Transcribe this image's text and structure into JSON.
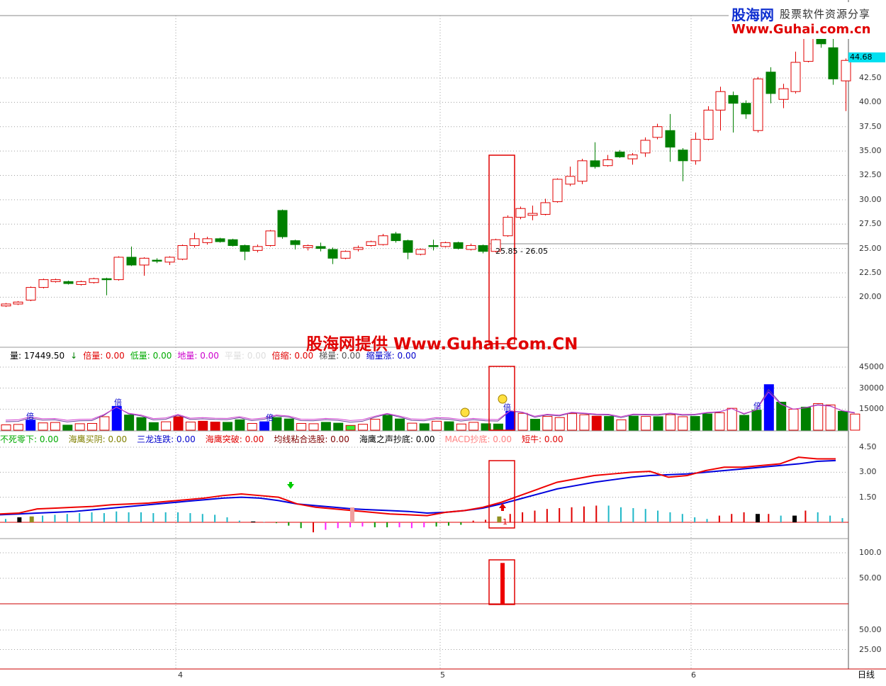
{
  "logo": {
    "brand": "股海网",
    "slogan": "股票软件资源分享",
    "url": "Www.Guhai.com.cn"
  },
  "watermark": "股海网提供 Www.Guhai.Com.CN",
  "price_panel": {
    "current_price": "44.68",
    "range_label": "25.85 - 26.05",
    "ticks": [
      "42.50",
      "40.00",
      "37.50",
      "35.00",
      "32.50",
      "30.00",
      "27.50",
      "25.00",
      "22.50",
      "20.00"
    ]
  },
  "volume_panel": {
    "items": [
      {
        "label": "量: 17449.50",
        "color": "#000000"
      },
      {
        "label": "↓",
        "color": "#008000"
      },
      {
        "label": "倍量: 0.00",
        "color": "#e00000"
      },
      {
        "label": "低量: 0.00",
        "color": "#00aa00"
      },
      {
        "label": "地量: 0.00",
        "color": "#cc00cc"
      },
      {
        "label": "平量: 0.00",
        "color": "#dddddd"
      },
      {
        "label": "倍缩: 0.00",
        "color": "#e00000"
      },
      {
        "label": "梯量: 0.00",
        "color": "#555555"
      },
      {
        "label": "缩量涨: 0.00",
        "color": "#0000cc"
      }
    ],
    "ticks": [
      "45000",
      "30000",
      "15000"
    ],
    "marker_bei": "倍"
  },
  "indicator_panel": {
    "items": [
      {
        "label": "不死零下: 0.00",
        "color": "#00aa00"
      },
      {
        "label": "海鹰买阴: 0.00",
        "color": "#808000"
      },
      {
        "label": "三龙连跌: 0.00",
        "color": "#0000cc"
      },
      {
        "label": "海鹰突破: 0.00",
        "color": "#e00000"
      },
      {
        "label": "均线粘合选股: 0.00",
        "color": "#800000"
      },
      {
        "label": "海鹰之声抄底: 0.00",
        "color": "#000000"
      },
      {
        "label": "MACD抄底: 0.00",
        "color": "#ff8080"
      },
      {
        "label": "短牛: 0.00",
        "color": "#e00000"
      }
    ],
    "ticks": [
      "4.50",
      "3.00",
      "1.50"
    ],
    "signal_value": "1"
  },
  "panel4": {
    "ticks": [
      "100.0",
      "50.00"
    ]
  },
  "panel5": {
    "ticks": [
      "50.00",
      "25.00"
    ]
  },
  "time_axis": {
    "labels": [
      "4",
      "5",
      "6"
    ]
  },
  "period_tab": "日线",
  "colors": {
    "up": "#e00000",
    "down": "#008000",
    "blue": "#0000ff",
    "cyan": "#20b0c0",
    "grid": "#a0a0a0"
  }
}
